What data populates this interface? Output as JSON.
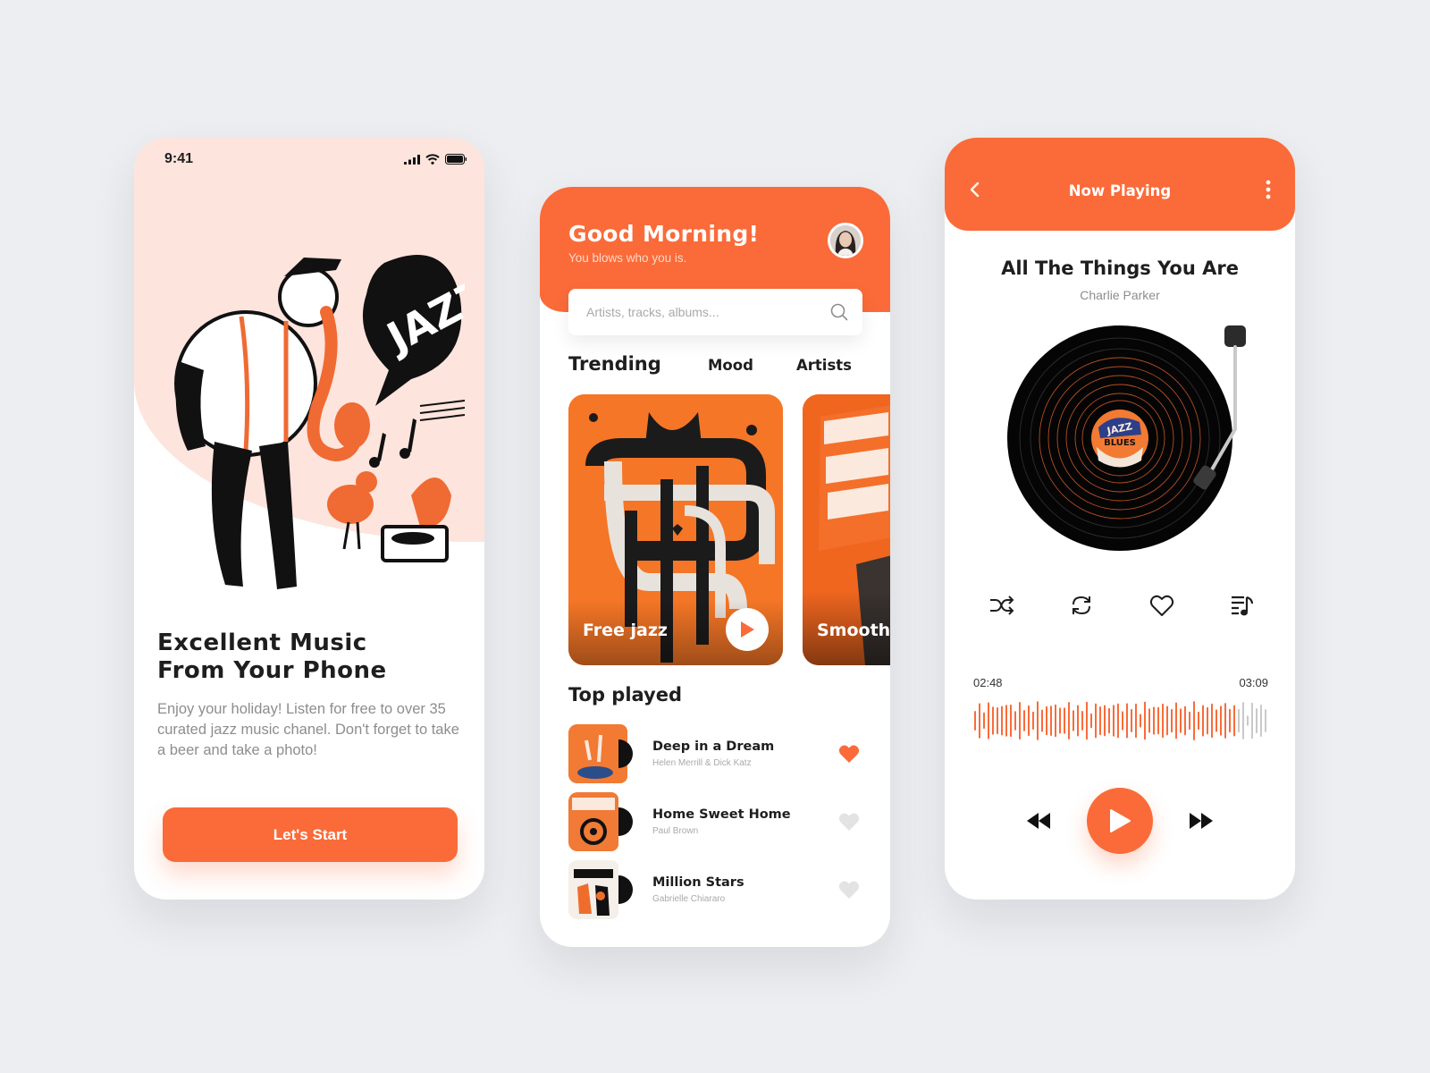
{
  "colors": {
    "accent": "#fa6b39",
    "hero_bg": "#fde4dd",
    "text_dark": "#1e1e1e",
    "text_muted": "#a9a9a9",
    "heart_inactive": "#e3e3e3"
  },
  "onboarding": {
    "status_time": "9:41",
    "title_line1": "Excellent Music",
    "title_line2": "From Your Phone",
    "description": "Enjoy your holiday! Listen for free to over 35 curated jazz music chanel. Don't forget to take a beer and take a photo!",
    "start_label": "Let's Start",
    "illustration_icon": "jazz-saxophonist-illustration",
    "speech_bubble_text": "JAZZ"
  },
  "home": {
    "greeting": "Good Morning!",
    "subtitle": "You blows who you is.",
    "search_placeholder": "Artists, tracks, albums...",
    "tabs": [
      {
        "label": "Trending",
        "active": true
      },
      {
        "label": "Mood",
        "active": false
      },
      {
        "label": "Artists",
        "active": false
      }
    ],
    "cards": [
      {
        "title": "Free jazz"
      },
      {
        "title": "Smooth"
      }
    ],
    "top_played_title": "Top played",
    "tracks": [
      {
        "name": "Deep in a Dream",
        "artist": "Helen Merrill & Dick Katz",
        "liked": true
      },
      {
        "name": "Home Sweet Home",
        "artist": "Paul Brown",
        "liked": false
      },
      {
        "name": "Million Stars",
        "artist": "Gabrielle Chiararo",
        "liked": false
      }
    ]
  },
  "now_playing": {
    "header_title": "Now Playing",
    "song_title": "All The Things You Are",
    "artist": "Charlie Parker",
    "record_label_line1": "JAZZ",
    "record_label_line2": "BLUES",
    "elapsed": "02:48",
    "duration": "03:09",
    "progress": 0.89
  }
}
